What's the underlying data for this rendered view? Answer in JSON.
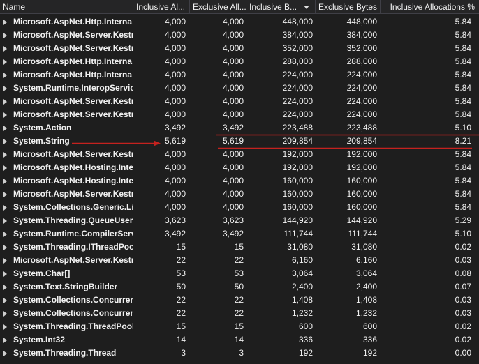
{
  "columns": [
    "Name",
    "Inclusive Al...",
    "Exclusive All...",
    "Inclusive B...",
    "Exclusive Bytes",
    "Inclusive Allocations %"
  ],
  "annotation_color": "#c5221f",
  "sort_icon": "sort-descending-icon",
  "expander_icon": "expand-arrow-icon",
  "rows": [
    {
      "name": "Microsoft.AspNet.Http.Interna",
      "incl_alloc": "4,000",
      "excl_alloc": "4,000",
      "incl_bytes": "448,000",
      "excl_bytes": "448,000",
      "incl_pct": "5.84"
    },
    {
      "name": "Microsoft.AspNet.Server.Kestr",
      "incl_alloc": "4,000",
      "excl_alloc": "4,000",
      "incl_bytes": "384,000",
      "excl_bytes": "384,000",
      "incl_pct": "5.84"
    },
    {
      "name": "Microsoft.AspNet.Server.Kestr",
      "incl_alloc": "4,000",
      "excl_alloc": "4,000",
      "incl_bytes": "352,000",
      "excl_bytes": "352,000",
      "incl_pct": "5.84"
    },
    {
      "name": "Microsoft.AspNet.Http.Interna",
      "incl_alloc": "4,000",
      "excl_alloc": "4,000",
      "incl_bytes": "288,000",
      "excl_bytes": "288,000",
      "incl_pct": "5.84"
    },
    {
      "name": "Microsoft.AspNet.Http.Interna",
      "incl_alloc": "4,000",
      "excl_alloc": "4,000",
      "incl_bytes": "224,000",
      "excl_bytes": "224,000",
      "incl_pct": "5.84"
    },
    {
      "name": "System.Runtime.InteropServic",
      "incl_alloc": "4,000",
      "excl_alloc": "4,000",
      "incl_bytes": "224,000",
      "excl_bytes": "224,000",
      "incl_pct": "5.84"
    },
    {
      "name": "Microsoft.AspNet.Server.Kestr",
      "incl_alloc": "4,000",
      "excl_alloc": "4,000",
      "incl_bytes": "224,000",
      "excl_bytes": "224,000",
      "incl_pct": "5.84"
    },
    {
      "name": "Microsoft.AspNet.Server.Kestr",
      "incl_alloc": "4,000",
      "excl_alloc": "4,000",
      "incl_bytes": "224,000",
      "excl_bytes": "224,000",
      "incl_pct": "5.84"
    },
    {
      "name": "System.Action",
      "incl_alloc": "3,492",
      "excl_alloc": "3,492",
      "incl_bytes": "223,488",
      "excl_bytes": "223,488",
      "incl_pct": "5.10"
    },
    {
      "name": "System.String",
      "incl_alloc": "5,619",
      "excl_alloc": "5,619",
      "incl_bytes": "209,854",
      "excl_bytes": "209,854",
      "incl_pct": "8.21"
    },
    {
      "name": "Microsoft.AspNet.Server.Kestr",
      "incl_alloc": "4,000",
      "excl_alloc": "4,000",
      "incl_bytes": "192,000",
      "excl_bytes": "192,000",
      "incl_pct": "5.84"
    },
    {
      "name": "Microsoft.AspNet.Hosting.Inte",
      "incl_alloc": "4,000",
      "excl_alloc": "4,000",
      "incl_bytes": "192,000",
      "excl_bytes": "192,000",
      "incl_pct": "5.84"
    },
    {
      "name": "Microsoft.AspNet.Hosting.Inte",
      "incl_alloc": "4,000",
      "excl_alloc": "4,000",
      "incl_bytes": "160,000",
      "excl_bytes": "160,000",
      "incl_pct": "5.84"
    },
    {
      "name": "Microsoft.AspNet.Server.Kestr",
      "incl_alloc": "4,000",
      "excl_alloc": "4,000",
      "incl_bytes": "160,000",
      "excl_bytes": "160,000",
      "incl_pct": "5.84"
    },
    {
      "name": "System.Collections.Generic.List",
      "incl_alloc": "4,000",
      "excl_alloc": "4,000",
      "incl_bytes": "160,000",
      "excl_bytes": "160,000",
      "incl_pct": "5.84"
    },
    {
      "name": "System.Threading.QueueUserW",
      "incl_alloc": "3,623",
      "excl_alloc": "3,623",
      "incl_bytes": "144,920",
      "excl_bytes": "144,920",
      "incl_pct": "5.29"
    },
    {
      "name": "System.Runtime.CompilerServ",
      "incl_alloc": "3,492",
      "excl_alloc": "3,492",
      "incl_bytes": "111,744",
      "excl_bytes": "111,744",
      "incl_pct": "5.10"
    },
    {
      "name": "System.Threading.IThreadPool",
      "incl_alloc": "15",
      "excl_alloc": "15",
      "incl_bytes": "31,080",
      "excl_bytes": "31,080",
      "incl_pct": "0.02"
    },
    {
      "name": "Microsoft.AspNet.Server.Kestr",
      "incl_alloc": "22",
      "excl_alloc": "22",
      "incl_bytes": "6,160",
      "excl_bytes": "6,160",
      "incl_pct": "0.03"
    },
    {
      "name": "System.Char[]",
      "incl_alloc": "53",
      "excl_alloc": "53",
      "incl_bytes": "3,064",
      "excl_bytes": "3,064",
      "incl_pct": "0.08"
    },
    {
      "name": "System.Text.StringBuilder",
      "incl_alloc": "50",
      "excl_alloc": "50",
      "incl_bytes": "2,400",
      "excl_bytes": "2,400",
      "incl_pct": "0.07"
    },
    {
      "name": "System.Collections.Concurrent",
      "incl_alloc": "22",
      "excl_alloc": "22",
      "incl_bytes": "1,408",
      "excl_bytes": "1,408",
      "incl_pct": "0.03"
    },
    {
      "name": "System.Collections.Concurrent",
      "incl_alloc": "22",
      "excl_alloc": "22",
      "incl_bytes": "1,232",
      "excl_bytes": "1,232",
      "incl_pct": "0.03"
    },
    {
      "name": "System.Threading.ThreadPoolW",
      "incl_alloc": "15",
      "excl_alloc": "15",
      "incl_bytes": "600",
      "excl_bytes": "600",
      "incl_pct": "0.02"
    },
    {
      "name": "System.Int32",
      "incl_alloc": "14",
      "excl_alloc": "14",
      "incl_bytes": "336",
      "excl_bytes": "336",
      "incl_pct": "0.02"
    },
    {
      "name": "System.Threading.Thread",
      "incl_alloc": "3",
      "excl_alloc": "3",
      "incl_bytes": "192",
      "excl_bytes": "192",
      "incl_pct": "0.00"
    }
  ]
}
